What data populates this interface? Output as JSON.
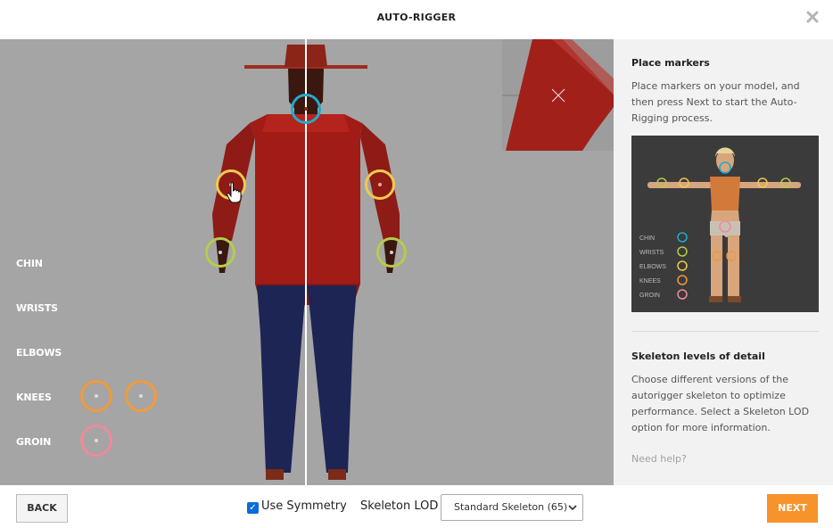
{
  "header": {
    "title": "AUTO-RIGGER"
  },
  "viewport": {
    "marker_labels": [
      "CHIN",
      "WRISTS",
      "ELBOWS",
      "KNEES",
      "GROIN"
    ],
    "colors": {
      "chin": "#22aacc",
      "wrists": "#b6cc4a",
      "elbows": "#f0c94e",
      "knees": "#f29a3a",
      "groin": "#f08a9b"
    }
  },
  "panel": {
    "place_title": "Place markers",
    "place_text": "Place markers on your model, and then press Next to start the Auto-Rigging process.",
    "ref_labels": [
      "CHIN",
      "WRISTS",
      "ELBOWS",
      "KNEES",
      "GROIN"
    ],
    "lod_title": "Skeleton levels of detail",
    "lod_text": "Choose different versions of the autorigger skeleton to optimize performance. Select a Skeleton LOD option for more information.",
    "help": "Need help?"
  },
  "footer": {
    "back": "BACK",
    "symmetry_label": "Use Symmetry",
    "symmetry_checked": true,
    "lod_label": "Skeleton LOD",
    "lod_value": "Standard Skeleton (65)",
    "next": "NEXT"
  }
}
